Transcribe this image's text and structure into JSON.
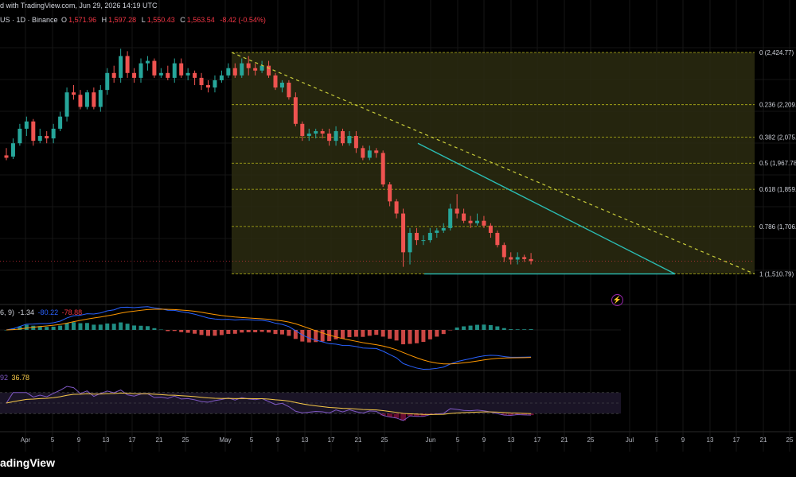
{
  "header": {
    "line1": "d with TradingView.com, Jun 29, 2026 14:19 UTC",
    "symbol": "US · 1D · Binance",
    "ohlc": [
      {
        "k": "O",
        "v": "1,571.96"
      },
      {
        "k": "H",
        "v": "1,597.28"
      },
      {
        "k": "L",
        "v": "1,550.43"
      },
      {
        "k": "C",
        "v": "1,563.54"
      }
    ],
    "change": "-8.42 (-0.54%)"
  },
  "macd_header": {
    "params": "6, 9)",
    "hist": "-1.34",
    "macd": "-80.22",
    "signal": "-78.88"
  },
  "rsi_header": {
    "params": "92",
    "value": "36.78"
  },
  "brand": "adingView",
  "colors": {
    "up": "#26a69a",
    "down": "#ef5350",
    "fib": "#b5b518",
    "fib_fill": "#2b2b10",
    "trend": "#2bbcb3",
    "dashed_trend": "#c8cc3a",
    "macd": "#2962ff",
    "signal": "#ff9800",
    "rsi": "#7e57c2",
    "rsi_ma": "#f7c948"
  },
  "chart_data": {
    "type": "candlestick",
    "x_ticks": [
      "Apr",
      "5",
      "9",
      "13",
      "17",
      "21",
      "25",
      "May",
      "5",
      "9",
      "13",
      "17",
      "21",
      "25",
      "Jun",
      "5",
      "9",
      "13",
      "17",
      "21",
      "25",
      "Jul",
      "5",
      "9",
      "13",
      "17",
      "21",
      "25"
    ],
    "fib_levels": [
      {
        "ratio": 0,
        "label": "0 (2,424.77)"
      },
      {
        "ratio": 0.236,
        "label": "0.236 (2,209.…"
      },
      {
        "ratio": 0.382,
        "label": "0.382 (2,075.…"
      },
      {
        "ratio": 0.5,
        "label": "0.5 (1,967.78"
      },
      {
        "ratio": 0.618,
        "label": "0.618 (1,859.…"
      },
      {
        "ratio": 0.786,
        "label": "0.786 (1,706.…"
      },
      {
        "ratio": 1,
        "label": "1 (1,510.79)"
      }
    ],
    "fib_high": 2424.77,
    "fib_low": 1510.79,
    "price_range": [
      1460,
      2510
    ],
    "candles": [
      [
        2000,
        1990,
        2030,
        1980
      ],
      [
        1995,
        2050,
        2070,
        1985
      ],
      [
        2050,
        2110,
        2130,
        2040
      ],
      [
        2110,
        2140,
        2160,
        2080
      ],
      [
        2140,
        2060,
        2150,
        2040
      ],
      [
        2060,
        2080,
        2110,
        2050
      ],
      [
        2080,
        2070,
        2100,
        2050
      ],
      [
        2070,
        2110,
        2130,
        2050
      ],
      [
        2110,
        2160,
        2180,
        2100
      ],
      [
        2160,
        2260,
        2280,
        2140
      ],
      [
        2260,
        2250,
        2290,
        2230
      ],
      [
        2250,
        2200,
        2270,
        2190
      ],
      [
        2200,
        2260,
        2270,
        2190
      ],
      [
        2260,
        2200,
        2280,
        2190
      ],
      [
        2200,
        2270,
        2290,
        2180
      ],
      [
        2270,
        2340,
        2360,
        2250
      ],
      [
        2340,
        2320,
        2370,
        2300
      ],
      [
        2320,
        2410,
        2440,
        2300
      ],
      [
        2410,
        2340,
        2430,
        2320
      ],
      [
        2340,
        2320,
        2360,
        2300
      ],
      [
        2320,
        2380,
        2400,
        2300
      ],
      [
        2380,
        2390,
        2410,
        2350
      ],
      [
        2390,
        2330,
        2400,
        2320
      ],
      [
        2330,
        2340,
        2360,
        2320
      ],
      [
        2340,
        2320,
        2370,
        2310
      ],
      [
        2320,
        2380,
        2400,
        2300
      ],
      [
        2380,
        2330,
        2400,
        2320
      ],
      [
        2330,
        2340,
        2360,
        2310
      ],
      [
        2340,
        2320,
        2350,
        2290
      ],
      [
        2320,
        2290,
        2340,
        2270
      ],
      [
        2290,
        2280,
        2310,
        2260
      ],
      [
        2280,
        2310,
        2330,
        2260
      ],
      [
        2310,
        2330,
        2350,
        2300
      ],
      [
        2330,
        2360,
        2380,
        2320
      ],
      [
        2360,
        2330,
        2380,
        2320
      ],
      [
        2330,
        2380,
        2400,
        2320
      ],
      [
        2380,
        2360,
        2410,
        2330
      ],
      [
        2360,
        2350,
        2380,
        2330
      ],
      [
        2350,
        2370,
        2390,
        2340
      ],
      [
        2370,
        2330,
        2390,
        2320
      ],
      [
        2330,
        2280,
        2340,
        2270
      ],
      [
        2280,
        2300,
        2310,
        2260
      ],
      [
        2300,
        2240,
        2310,
        2230
      ],
      [
        2240,
        2130,
        2260,
        2120
      ],
      [
        2130,
        2080,
        2140,
        2060
      ],
      [
        2080,
        2090,
        2110,
        2060
      ],
      [
        2090,
        2100,
        2110,
        2070
      ],
      [
        2100,
        2090,
        2110,
        2070
      ],
      [
        2090,
        2060,
        2110,
        2040
      ],
      [
        2060,
        2100,
        2120,
        2040
      ],
      [
        2100,
        2050,
        2110,
        2040
      ],
      [
        2050,
        2080,
        2100,
        2040
      ],
      [
        2080,
        2030,
        2100,
        2010
      ],
      [
        2030,
        1990,
        2040,
        1980
      ],
      [
        1990,
        2020,
        2040,
        1980
      ],
      [
        2020,
        2010,
        2030,
        1990
      ],
      [
        2010,
        1880,
        2020,
        1870
      ],
      [
        1880,
        1810,
        1890,
        1790
      ],
      [
        1810,
        1760,
        1820,
        1740
      ],
      [
        1760,
        1600,
        1780,
        1540
      ],
      [
        1600,
        1680,
        1700,
        1550
      ],
      [
        1680,
        1650,
        1700,
        1630
      ],
      [
        1650,
        1650,
        1670,
        1630
      ],
      [
        1650,
        1680,
        1700,
        1640
      ],
      [
        1680,
        1690,
        1700,
        1660
      ],
      [
        1690,
        1700,
        1720,
        1680
      ],
      [
        1700,
        1780,
        1800,
        1690
      ],
      [
        1780,
        1760,
        1840,
        1740
      ],
      [
        1760,
        1730,
        1780,
        1720
      ],
      [
        1730,
        1720,
        1750,
        1700
      ],
      [
        1720,
        1730,
        1760,
        1710
      ],
      [
        1730,
        1710,
        1750,
        1700
      ],
      [
        1710,
        1680,
        1720,
        1660
      ],
      [
        1680,
        1630,
        1690,
        1620
      ],
      [
        1630,
        1580,
        1640,
        1560
      ],
      [
        1580,
        1570,
        1600,
        1550
      ],
      [
        1570,
        1580,
        1600,
        1550
      ],
      [
        1580,
        1572,
        1590,
        1560
      ],
      [
        1572,
        1564,
        1597,
        1550
      ]
    ],
    "macd": {
      "params": "6, 9)",
      "histogram": -1.34,
      "macd": -80.22,
      "signal": -78.88
    },
    "rsi": {
      "params": "92",
      "value": 36.78
    }
  }
}
